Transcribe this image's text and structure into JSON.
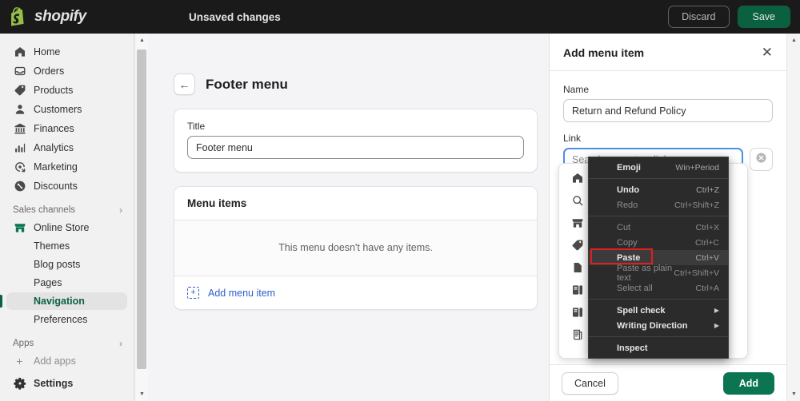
{
  "topbar": {
    "brand": "shopify",
    "brand_icon": "shopify-bag-icon",
    "status": "Unsaved changes",
    "discard_label": "Discard",
    "save_label": "Save",
    "bg": "#1a1a1a",
    "save_bg": "#0b613f"
  },
  "sidebar": {
    "primary": [
      {
        "label": "Home",
        "icon": "home-icon"
      },
      {
        "label": "Orders",
        "icon": "orders-inbox-icon"
      },
      {
        "label": "Products",
        "icon": "products-tag-icon"
      },
      {
        "label": "Customers",
        "icon": "customers-person-icon"
      },
      {
        "label": "Finances",
        "icon": "finances-bank-icon"
      },
      {
        "label": "Analytics",
        "icon": "analytics-bars-icon"
      },
      {
        "label": "Marketing",
        "icon": "marketing-megaphone-icon"
      },
      {
        "label": "Discounts",
        "icon": "discounts-percent-icon"
      }
    ],
    "sales_channels_label": "Sales channels",
    "online_store": {
      "label": "Online Store",
      "icon": "storefront-icon"
    },
    "store_subitems": [
      {
        "label": "Themes",
        "active": false
      },
      {
        "label": "Blog posts",
        "active": false
      },
      {
        "label": "Pages",
        "active": false
      },
      {
        "label": "Navigation",
        "active": true
      },
      {
        "label": "Preferences",
        "active": false
      }
    ],
    "apps_label": "Apps",
    "add_apps_label": "Add apps",
    "settings_label": "Settings",
    "active_color": "#0b6048"
  },
  "main": {
    "back_icon": "arrow-left-icon",
    "page_title": "Footer menu",
    "title_field_label": "Title",
    "title_field_value": "Footer menu",
    "menu_items_card_title": "Menu items",
    "empty_state": "This menu doesn't have any items.",
    "add_menu_item_label": "Add menu item",
    "link_color": "#2c5ecf"
  },
  "panel": {
    "title": "Add menu item",
    "close_icon": "close-icon",
    "name_label": "Name",
    "name_value": "Return and Refund Policy",
    "link_label": "Link",
    "link_placeholder": "Search or paste a link",
    "link_value": "",
    "clear_icon": "clear-circle-icon",
    "cancel_label": "Cancel",
    "add_label": "Add",
    "add_bg": "#0b7552",
    "focus_border": "#4d8de8",
    "suggestions": [
      {
        "label": "Home",
        "icon": "home-icon"
      },
      {
        "label": "Search",
        "icon": "search-icon"
      },
      {
        "label": "Storefront",
        "icon": "storefront-icon"
      },
      {
        "label": "Products",
        "icon": "products-tag-icon"
      },
      {
        "label": "Pages",
        "icon": "page-icon"
      },
      {
        "label": "Collections",
        "icon": "collection-icon"
      },
      {
        "label": "Blogs",
        "icon": "collection-icon"
      },
      {
        "label": "Policies",
        "icon": "policies-icon"
      }
    ]
  },
  "context_menu": {
    "highlight_color": "#e02020",
    "bg": "#2b2b2b",
    "groups": [
      [
        {
          "label": "Emoji",
          "accel": "Win+Period",
          "disabled": false,
          "submenu": false,
          "highlighted": false
        }
      ],
      [
        {
          "label": "Undo",
          "accel": "Ctrl+Z",
          "disabled": false,
          "submenu": false,
          "highlighted": false
        },
        {
          "label": "Redo",
          "accel": "Ctrl+Shift+Z",
          "disabled": true,
          "submenu": false,
          "highlighted": false
        }
      ],
      [
        {
          "label": "Cut",
          "accel": "Ctrl+X",
          "disabled": true,
          "submenu": false,
          "highlighted": false
        },
        {
          "label": "Copy",
          "accel": "Ctrl+C",
          "disabled": true,
          "submenu": false,
          "highlighted": false
        },
        {
          "label": "Paste",
          "accel": "Ctrl+V",
          "disabled": false,
          "submenu": false,
          "highlighted": true
        },
        {
          "label": "Paste as plain text",
          "accel": "Ctrl+Shift+V",
          "disabled": true,
          "submenu": false,
          "highlighted": false
        },
        {
          "label": "Select all",
          "accel": "Ctrl+A",
          "disabled": true,
          "submenu": false,
          "highlighted": false
        }
      ],
      [
        {
          "label": "Spell check",
          "accel": "",
          "disabled": false,
          "submenu": true,
          "highlighted": false
        },
        {
          "label": "Writing Direction",
          "accel": "",
          "disabled": false,
          "submenu": true,
          "highlighted": false
        }
      ],
      [
        {
          "label": "Inspect",
          "accel": "",
          "disabled": false,
          "submenu": false,
          "highlighted": false
        }
      ]
    ]
  },
  "scrollbars": {
    "up_arrow": "▲",
    "down_arrow": "▼"
  }
}
